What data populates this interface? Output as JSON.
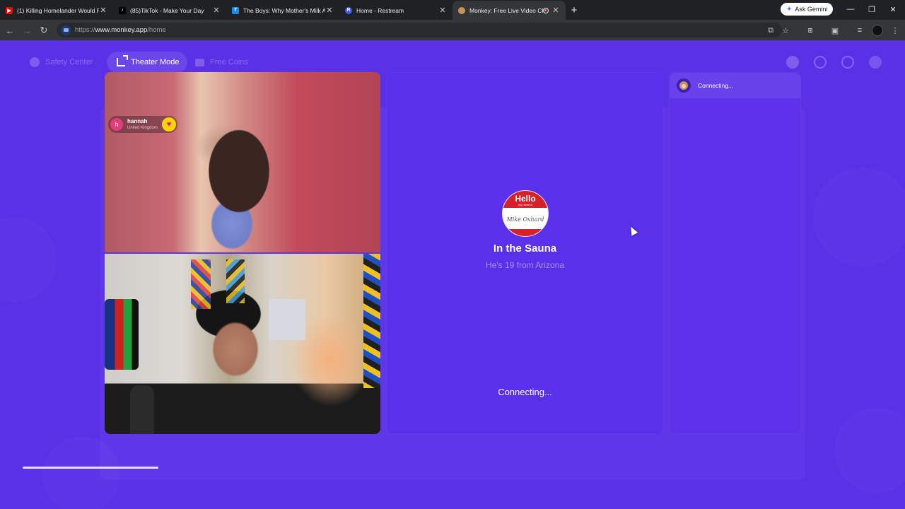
{
  "browser": {
    "tabs": [
      {
        "title": "(1) Killing Homelander Would F",
        "favicon": "youtube-icon",
        "color": "#ff0000"
      },
      {
        "title": "(85)TikTok - Make Your Day",
        "favicon": "tiktok-icon",
        "color": "#000000"
      },
      {
        "title": "The Boys: Why Mother's Milk A",
        "favicon": "tv-icon",
        "color": "#1e88e5"
      },
      {
        "title": "Home - Restream",
        "favicon": "restream-icon",
        "color": "#3b5cf0"
      },
      {
        "title": "Monkey: Free Live Video Ch",
        "favicon": "monkey-icon",
        "color": "#c9925a",
        "active": true
      }
    ],
    "ask_gemini": "Ask Gemini",
    "url_scheme": "https://",
    "url_host": "www.monkey.app",
    "url_path": "/home"
  },
  "page": {
    "nav": {
      "safety_center": "Safety Center",
      "theater_mode": "Theater Mode",
      "free_coins": "Free Coins"
    },
    "remote_user": {
      "initial": "h",
      "name": "hannah",
      "country": "United Kingdom"
    },
    "room": {
      "badge_hello": "Hello",
      "badge_my_name_is": "my name is",
      "badge_name": "Mike Oxhard",
      "title": "In the Sauna",
      "subtitle": "He's 19 from Arizona",
      "status": "Connecting..."
    },
    "sidebar": {
      "status": "Connecting..."
    },
    "colors": {
      "background": "#5b31e8",
      "heart_button": "#ffd400",
      "avatar": "#e23c7a"
    }
  }
}
